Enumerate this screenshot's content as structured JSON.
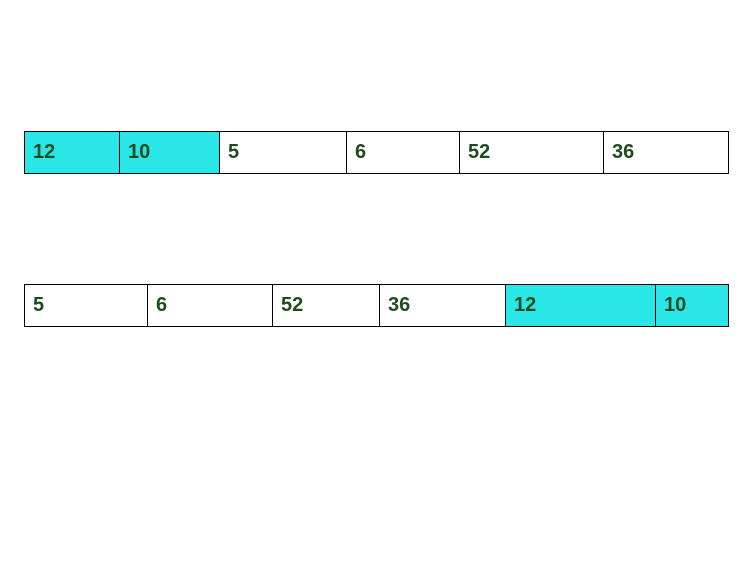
{
  "rows": [
    {
      "cells": [
        {
          "value": "12",
          "highlight": true
        },
        {
          "value": "10",
          "highlight": true
        },
        {
          "value": "5",
          "highlight": false
        },
        {
          "value": "6",
          "highlight": false
        },
        {
          "value": "52",
          "highlight": false
        },
        {
          "value": "36",
          "highlight": false
        }
      ]
    },
    {
      "cells": [
        {
          "value": "5",
          "highlight": false
        },
        {
          "value": "6",
          "highlight": false
        },
        {
          "value": "52",
          "highlight": false
        },
        {
          "value": "36",
          "highlight": false
        },
        {
          "value": "12",
          "highlight": true
        },
        {
          "value": "10",
          "highlight": true
        }
      ]
    }
  ],
  "colors": {
    "highlight": "#29e7e7",
    "text": "#1d4d1d"
  }
}
